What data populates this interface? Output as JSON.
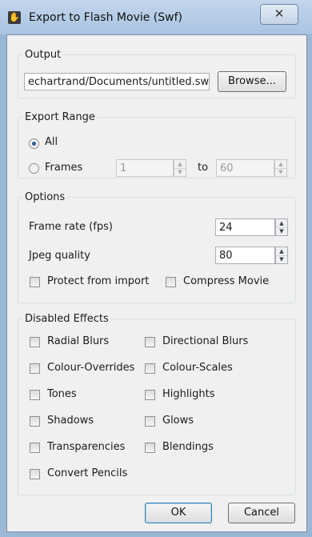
{
  "window": {
    "title": "Export to Flash Movie (Swf)",
    "close_glyph": "✕",
    "app_icon": "hand-icon"
  },
  "output": {
    "legend": "Output",
    "path_value": "echartrand/Documents/untitled.swf",
    "browse_label": "Browse..."
  },
  "export_range": {
    "legend": "Export Range",
    "all_label": "All",
    "all_selected": true,
    "frames_label": "Frames",
    "from_value": "1",
    "to_label": "to",
    "to_value": "60"
  },
  "options": {
    "legend": "Options",
    "frame_rate_label": "Frame rate (fps)",
    "frame_rate_value": "24",
    "jpeg_quality_label": "Jpeg quality",
    "jpeg_quality_value": "80",
    "protect_label": "Protect from import",
    "protect_checked": false,
    "compress_label": "Compress Movie",
    "compress_checked": false
  },
  "disabled_effects": {
    "legend": "Disabled Effects",
    "left": [
      "Radial Blurs",
      "Colour-Overrides",
      "Tones",
      "Shadows",
      "Transparencies",
      "Convert Pencils"
    ],
    "right": [
      "Directional Blurs",
      "Colour-Scales",
      "Highlights",
      "Glows",
      "Blendings"
    ]
  },
  "buttons": {
    "ok_label": "OK",
    "cancel_label": "Cancel"
  },
  "colors": {
    "titlebar": "#a9c3e0",
    "dialog_bg": "#f0f0f0",
    "default_button_border": "#3c7fb1"
  }
}
